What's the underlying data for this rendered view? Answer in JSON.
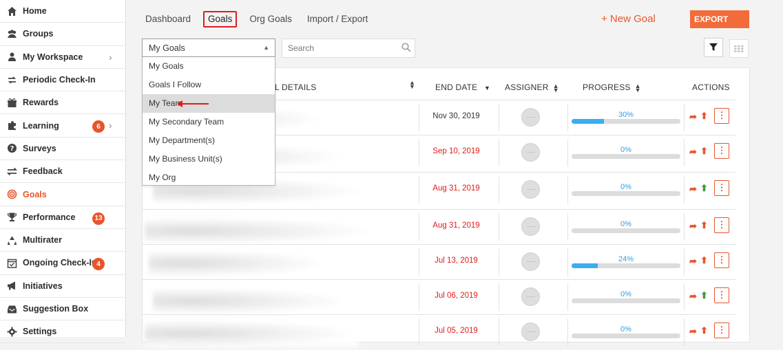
{
  "sidebar": {
    "items": [
      {
        "label": "Home",
        "icon": "home-icon",
        "badge": null,
        "chevron": false,
        "active": false
      },
      {
        "label": "Groups",
        "icon": "groups-icon",
        "badge": null,
        "chevron": false,
        "active": false
      },
      {
        "label": "My Workspace",
        "icon": "user-icon",
        "badge": null,
        "chevron": true,
        "active": false
      },
      {
        "label": "Periodic Check-In",
        "icon": "sync-icon",
        "badge": null,
        "chevron": false,
        "active": false
      },
      {
        "label": "Rewards",
        "icon": "gift-icon",
        "badge": null,
        "chevron": false,
        "active": false
      },
      {
        "label": "Learning",
        "icon": "puzzle-icon",
        "badge": "6",
        "chevron": true,
        "active": false
      },
      {
        "label": "Surveys",
        "icon": "question-icon",
        "badge": null,
        "chevron": false,
        "active": false
      },
      {
        "label": "Feedback",
        "icon": "exchange-icon",
        "badge": null,
        "chevron": false,
        "active": false
      },
      {
        "label": "Goals",
        "icon": "target-icon",
        "badge": null,
        "chevron": false,
        "active": true
      },
      {
        "label": "Performance",
        "icon": "trophy-icon",
        "badge": "13",
        "chevron": false,
        "active": false
      },
      {
        "label": "Multirater",
        "icon": "recycle-icon",
        "badge": null,
        "chevron": false,
        "active": false
      },
      {
        "label": "Ongoing Check-In",
        "icon": "calendar-check-icon",
        "badge": "4",
        "chevron": false,
        "active": false
      },
      {
        "label": "Initiatives",
        "icon": "bullhorn-icon",
        "badge": null,
        "chevron": false,
        "active": false
      },
      {
        "label": "Suggestion Box",
        "icon": "inbox-icon",
        "badge": null,
        "chevron": false,
        "active": false
      },
      {
        "label": "Settings",
        "icon": "gear-icon",
        "badge": null,
        "chevron": false,
        "active": false
      }
    ]
  },
  "tabs": [
    "Dashboard",
    "Goals",
    "Org Goals",
    "Import / Export"
  ],
  "active_tab": "Goals",
  "new_goal_label": "+ New Goal",
  "export_label": "EXPORT",
  "view_select": {
    "selected": "My Goals",
    "options": [
      "My Goals",
      "Goals I Follow",
      "My Team",
      "My Secondary Team",
      "My Department(s)",
      "My Business Unit(s)",
      "My Org"
    ],
    "hovered": "My Team"
  },
  "search": {
    "placeholder": "Search",
    "value": ""
  },
  "table": {
    "headers": {
      "details": "L DETAILS",
      "end_date": "END DATE",
      "assigner": "ASSIGNER",
      "progress": "PROGRESS",
      "actions": "ACTIONS"
    },
    "rows": [
      {
        "end_date": "Nov 30, 2019",
        "overdue": false,
        "progress": 30,
        "progress_label": "30%",
        "arrow_color": "#e8552b"
      },
      {
        "end_date": "Sep 10, 2019",
        "overdue": true,
        "progress": 0,
        "progress_label": "0%",
        "arrow_color": "#e8552b"
      },
      {
        "end_date": "Aug 31, 2019",
        "overdue": true,
        "progress": 0,
        "progress_label": "0%",
        "arrow_color": "#3d9a3d"
      },
      {
        "end_date": "Aug 31, 2019",
        "overdue": true,
        "progress": 0,
        "progress_label": "0%",
        "arrow_color": "#e8552b"
      },
      {
        "end_date": "Jul 13, 2019",
        "overdue": true,
        "progress": 24,
        "progress_label": "24%",
        "arrow_color": "#e8552b"
      },
      {
        "end_date": "Jul 06, 2019",
        "overdue": true,
        "progress": 0,
        "progress_label": "0%",
        "arrow_color": "#3d9a3d"
      },
      {
        "end_date": "Jul 05, 2019",
        "overdue": true,
        "progress": 0,
        "progress_label": "0%",
        "arrow_color": "#e8552b"
      }
    ]
  },
  "colors": {
    "accent": "#e8552b",
    "overdue": "#e01b1b",
    "normal_date": "#333333",
    "progress": "#3aaef0"
  }
}
